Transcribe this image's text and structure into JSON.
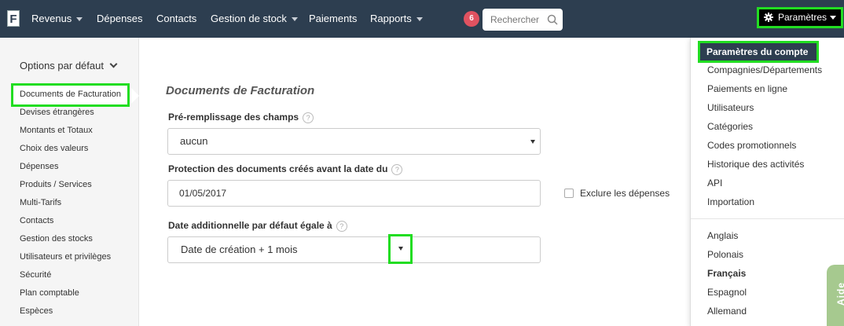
{
  "topbar": {
    "logo": "F",
    "nav": [
      "Revenus",
      "Dépenses",
      "Contacts",
      "Gestion de stock",
      "Paiements",
      "Rapports"
    ],
    "badge": "6",
    "search_placeholder": "Rechercher",
    "params_label": "Paramètres"
  },
  "sidebar": {
    "title": "Options par défaut",
    "items": [
      "Documents de Facturation",
      "Devises étrangères",
      "Montants et Totaux",
      "Choix des valeurs",
      "Dépenses",
      "Produits / Services",
      "Multi-Tarifs",
      "Contacts",
      "Gestion des stocks",
      "Utilisateurs et privilèges",
      "Sécurité",
      "Plan comptable",
      "Espèces"
    ]
  },
  "main": {
    "title": "Documents de Facturation",
    "prefill_label": "Pré-remplissage des champs",
    "prefill_value": "aucun",
    "protection_label": "Protection des documents créés avant la date du",
    "protection_date": "01/05/2017",
    "exclude_label": "Exclure les dépenses",
    "extra_date_label": "Date additionnelle par défaut égale à",
    "extra_date_value": "Date de création + 1 mois",
    "help_mark": "?"
  },
  "dropdown": {
    "highlighted": "Paramètres du compte",
    "items": [
      "Compagnies/Départements",
      "Paiements en ligne",
      "Utilisateurs",
      "Catégories",
      "Codes promotionnels",
      "Historique des activités",
      "API",
      "Importation"
    ],
    "languages": [
      "Anglais",
      "Polonais",
      "Français",
      "Espagnol",
      "Allemand"
    ],
    "active_language": "Français"
  },
  "aide": "Aide",
  "colors": {
    "topbar": "#2d3e50",
    "highlight": "#22dd22",
    "badge": "#e05260",
    "aide": "#a6c98f"
  }
}
